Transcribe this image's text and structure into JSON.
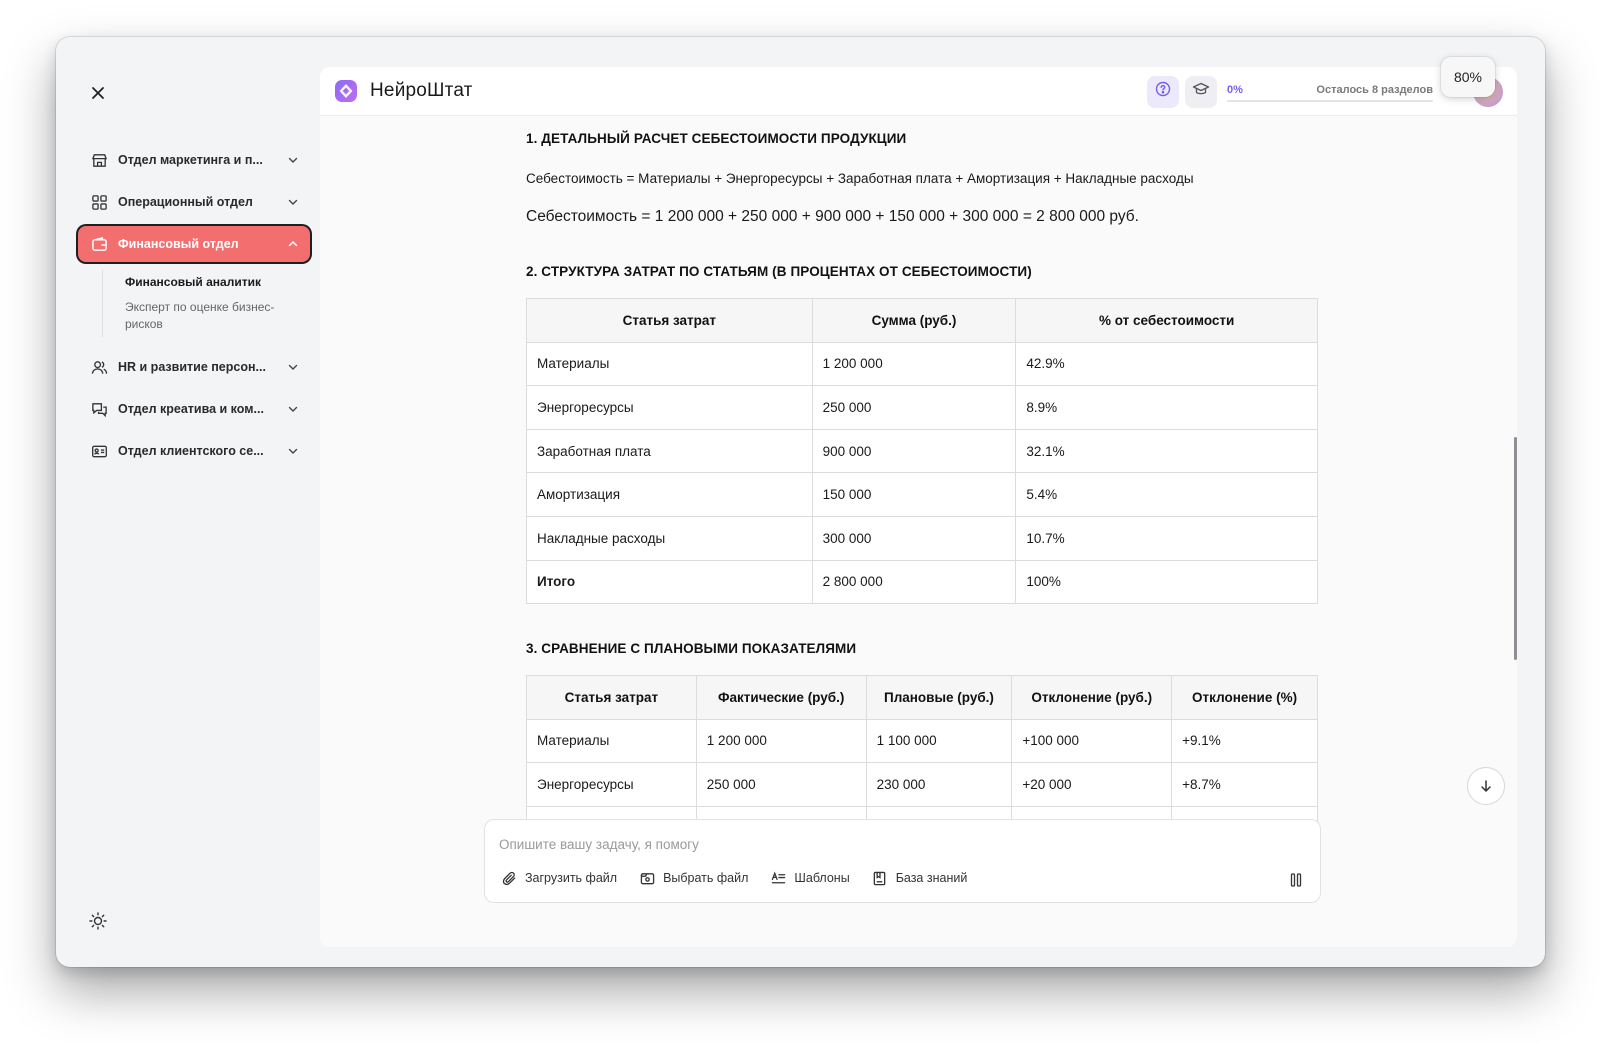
{
  "app": {
    "brand_name": "НейроШтат",
    "zoom": "80%"
  },
  "topbar": {
    "progress_pct": "0%",
    "progress_value": 0,
    "remaining_label": "Осталось 8 разделов",
    "help_icon": "help-circle-icon",
    "learn_icon": "graduation-cap-icon"
  },
  "sidebar": {
    "items": [
      {
        "label": "Отдел маркетинга и п...",
        "icon": "store-icon",
        "expanded": false
      },
      {
        "label": "Операционный отдел",
        "icon": "grid-icon",
        "expanded": false
      },
      {
        "label": "Финансовый отдел",
        "icon": "wallet-icon",
        "expanded": true,
        "active": true
      },
      {
        "label": "HR и развитие персон...",
        "icon": "users-icon",
        "expanded": false
      },
      {
        "label": "Отдел креатива и ком...",
        "icon": "chat-icon",
        "expanded": false
      },
      {
        "label": "Отдел клиентского се...",
        "icon": "id-card-icon",
        "expanded": false
      }
    ],
    "sub_items": [
      {
        "label": "Финансовый аналитик",
        "current": true
      },
      {
        "label": "Эксперт по оценке бизнес-рисков",
        "current": false
      }
    ]
  },
  "content": {
    "section1_title": "1. ДЕТАЛЬНЫЙ РАСЧЕТ СЕБЕСТОИМОСТИ ПРОДУКЦИИ",
    "formula_text": "Себестоимость = Материалы + Энергоресурсы + Заработная плата + Амортизация + Накладные расходы",
    "formula_calc": "Себестоимость = 1 200 000 + 250 000 + 900 000 + 150 000 + 300 000 = 2 800 000 руб.",
    "section2_title": "2. СТРУКТУРА ЗАТРАТ ПО СТАТЬЯМ (В ПРОЦЕНТАХ ОТ СЕБЕСТОИМОСТИ)",
    "table1": {
      "headers": [
        "Статья затрат",
        "Сумма (руб.)",
        "% от себестоимости"
      ],
      "rows": [
        [
          "Материалы",
          "1 200 000",
          "42.9%"
        ],
        [
          "Энергоресурсы",
          "250 000",
          "8.9%"
        ],
        [
          "Заработная плата",
          "900 000",
          "32.1%"
        ],
        [
          "Амортизация",
          "150 000",
          "5.4%"
        ],
        [
          "Накладные расходы",
          "300 000",
          "10.7%"
        ],
        [
          "Итого",
          "2 800 000",
          "100%"
        ]
      ]
    },
    "section3_title": "3. СРАВНЕНИЕ С ПЛАНОВЫМИ ПОКАЗАТЕЛЯМИ",
    "table2": {
      "headers": [
        "Статья затрат",
        "Фактические (руб.)",
        "Плановые (руб.)",
        "Отклонение (руб.)",
        "Отклонение (%)"
      ],
      "rows": [
        [
          "Материалы",
          "1 200 000",
          "1 100 000",
          "+100 000",
          "+9.1%"
        ],
        [
          "Энергоресурсы",
          "250 000",
          "230 000",
          "+20 000",
          "+8.7%"
        ]
      ]
    }
  },
  "composer": {
    "placeholder": "Опишите вашу задачу, я помогу",
    "upload_label": "Загрузить файл",
    "choose_label": "Выбрать файл",
    "templates_label": "Шаблоны",
    "kb_label": "База знаний"
  },
  "colors": {
    "accent": "#7b5cf0",
    "active_nav": "#f36f6f"
  }
}
